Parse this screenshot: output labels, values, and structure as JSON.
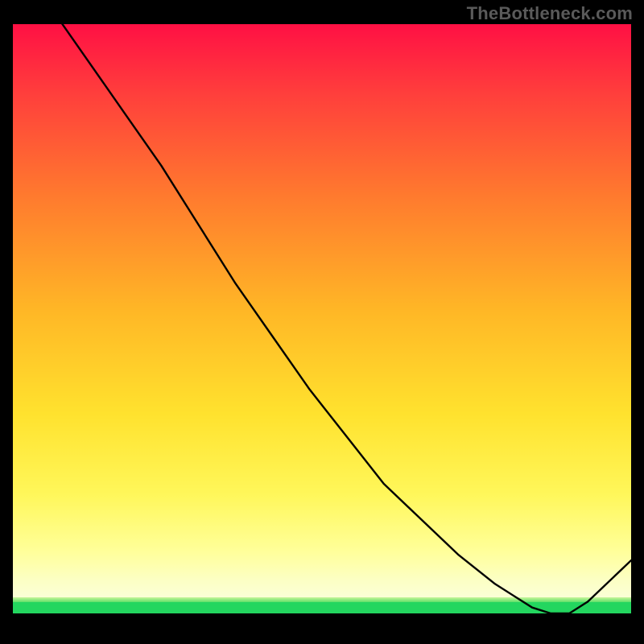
{
  "watermark": "TheBottleneck.com",
  "annotation_label": "",
  "colors": {
    "accent_red": "#be2a2a",
    "green_bar": "#23d65f",
    "watermark": "#5a5a5a"
  },
  "chart_data": {
    "type": "line",
    "title": "",
    "xlabel": "",
    "ylabel": "",
    "xlim": [
      0,
      100
    ],
    "ylim": [
      0,
      100
    ],
    "x": [
      0,
      4,
      6,
      12,
      18,
      24,
      30,
      36,
      42,
      48,
      54,
      60,
      66,
      72,
      78,
      84,
      87,
      90,
      93,
      100
    ],
    "values": [
      112,
      106,
      103,
      94,
      85,
      76,
      66,
      56,
      47,
      38,
      30,
      22,
      16,
      10,
      5,
      1,
      0,
      0,
      2,
      9
    ],
    "gradient_stops": [
      {
        "pct": 0,
        "color": "#ff1044"
      },
      {
        "pct": 12,
        "color": "#ff3e3c"
      },
      {
        "pct": 30,
        "color": "#ff7a2e"
      },
      {
        "pct": 50,
        "color": "#ffb726"
      },
      {
        "pct": 68,
        "color": "#ffe22e"
      },
      {
        "pct": 82,
        "color": "#fff75a"
      },
      {
        "pct": 92,
        "color": "#ffff9a"
      },
      {
        "pct": 97,
        "color": "#fcffc4"
      },
      {
        "pct": 100,
        "color": "#fbffd6"
      }
    ],
    "annotation_x": 88,
    "annotation_y": 0
  }
}
